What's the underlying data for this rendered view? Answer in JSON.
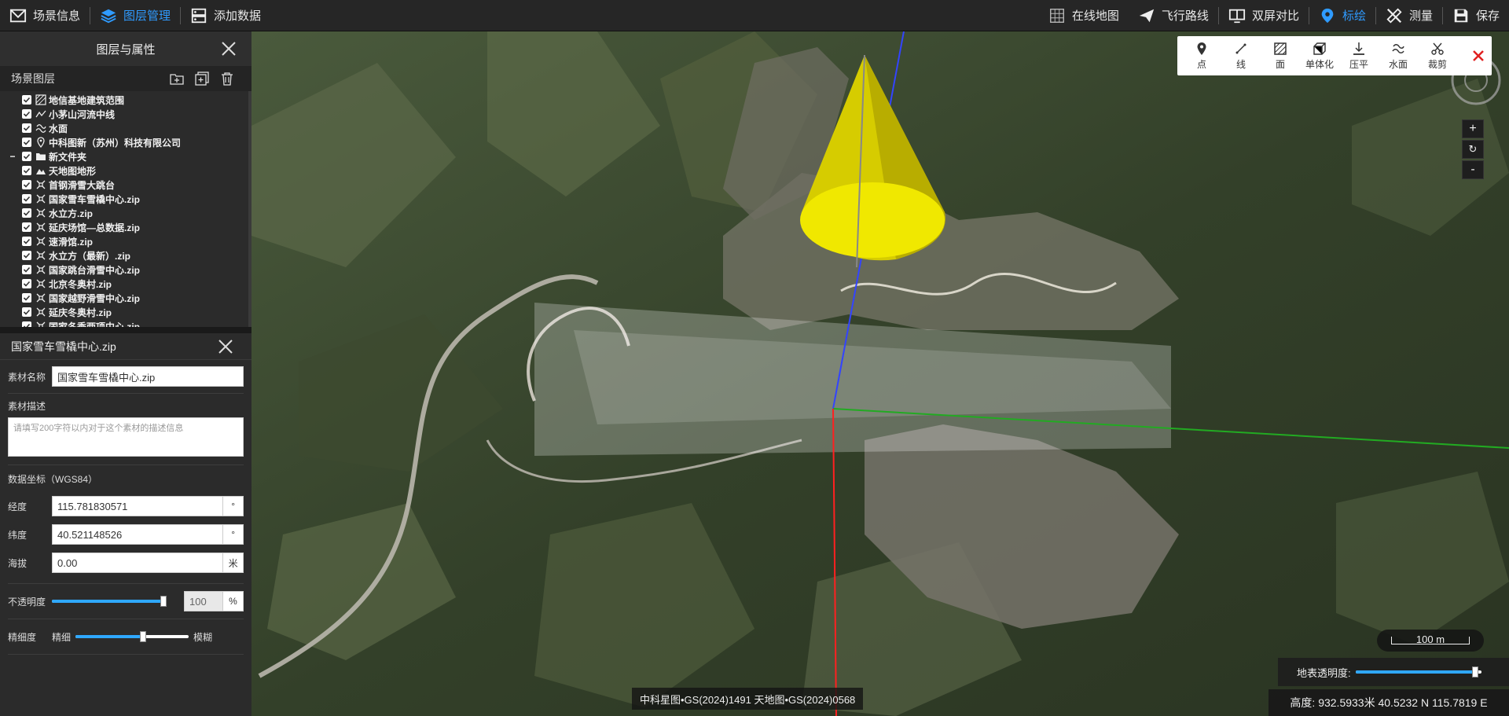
{
  "topbar": {
    "left": [
      {
        "label": "场景信息",
        "icon": "scene-info-icon"
      },
      {
        "label": "图层管理",
        "icon": "layers-icon",
        "active": true
      },
      {
        "label": "添加数据",
        "icon": "add-data-icon"
      }
    ],
    "right": [
      {
        "label": "在线地图",
        "icon": "online-map-icon"
      },
      {
        "label": "飞行路线",
        "icon": "flight-route-icon"
      },
      {
        "label": "双屏对比",
        "icon": "dual-screen-icon"
      },
      {
        "label": "标绘",
        "icon": "map-pin-icon",
        "active": true
      },
      {
        "label": "测量",
        "icon": "measure-icon"
      },
      {
        "label": "保存",
        "icon": "save-icon"
      }
    ]
  },
  "layer_panel": {
    "title": "图层与属性",
    "scene_layers_label": "场景图层",
    "items": [
      {
        "label": "地信基地建筑范围",
        "icon": "polygon-icon",
        "indent": 0
      },
      {
        "label": "小茅山河流中线",
        "icon": "polyline-icon",
        "indent": 0
      },
      {
        "label": "水面",
        "icon": "water-icon",
        "indent": 0
      },
      {
        "label": "中科图新（苏州）科技有限公司",
        "icon": "pin-icon",
        "indent": 0
      },
      {
        "label": "新文件夹",
        "icon": "folder-icon",
        "indent": 0,
        "expand": "−"
      },
      {
        "label": "天地图地形",
        "icon": "terrain-icon",
        "indent": 0
      },
      {
        "label": "首钢滑雪大跳台",
        "icon": "model-icon",
        "indent": 0
      },
      {
        "label": "国家雪车雪橇中心.zip",
        "icon": "model-icon",
        "indent": 0
      },
      {
        "label": "水立方.zip",
        "icon": "model-icon",
        "indent": 0
      },
      {
        "label": "延庆场馆—总数据.zip",
        "icon": "model-icon",
        "indent": 0
      },
      {
        "label": "速滑馆.zip",
        "icon": "model-icon",
        "indent": 0
      },
      {
        "label": "水立方（最新）.zip",
        "icon": "model-icon",
        "indent": 0
      },
      {
        "label": "国家跳台滑雪中心.zip",
        "icon": "model-icon",
        "indent": 0
      },
      {
        "label": "北京冬奥村.zip",
        "icon": "model-icon",
        "indent": 0
      },
      {
        "label": "国家越野滑雪中心.zip",
        "icon": "model-icon",
        "indent": 0
      },
      {
        "label": "延庆冬奥村.zip",
        "icon": "model-icon",
        "indent": 0
      },
      {
        "label": "国家冬季两项中心.zip",
        "icon": "model-icon",
        "indent": 0
      }
    ]
  },
  "properties": {
    "title": "国家雪车雪橇中心.zip",
    "name_label": "素材名称",
    "name_value": "国家雪车雪橇中心.zip",
    "desc_label": "素材描述",
    "desc_placeholder": "请填写200字符以内对于这个素材的描述信息",
    "coord_label": "数据坐标（WGS84）",
    "lon_label": "经度",
    "lon_value": "115.781830571",
    "lon_unit": "°",
    "lat_label": "纬度",
    "lat_value": "40.521148526",
    "lat_unit": "°",
    "alt_label": "海拔",
    "alt_value": "0.00",
    "alt_unit": "米",
    "opacity_label": "不透明度",
    "opacity_value": "100",
    "opacity_unit": "%",
    "opacity_fraction": 1.0,
    "detail_label": "精细度",
    "detail_fine": "精细",
    "detail_coarse": "模糊",
    "detail_fraction": 0.6
  },
  "draw_toolbar": [
    {
      "label": "点",
      "icon": "point-icon"
    },
    {
      "label": "线",
      "icon": "line-icon"
    },
    {
      "label": "面",
      "icon": "area-icon"
    },
    {
      "label": "单体化",
      "icon": "monomer-icon"
    },
    {
      "label": "压平",
      "icon": "flatten-icon"
    },
    {
      "label": "水面",
      "icon": "water-surface-icon"
    },
    {
      "label": "裁剪",
      "icon": "clip-icon"
    }
  ],
  "map": {
    "zoom_in": "+",
    "reset": "↻",
    "zoom_out": "-",
    "scale": "100 m",
    "surface_alpha_label": "地表透明度:",
    "surface_alpha_fraction": 0.95,
    "status": "高度: 932.5933米 40.5232 N 115.7819 E",
    "credit": "中科星图•GS(2024)1491 天地图•GS(2024)0568"
  },
  "colors": {
    "accent": "#2f9bff",
    "cone": "#e8e000",
    "close_red": "#e02020"
  }
}
